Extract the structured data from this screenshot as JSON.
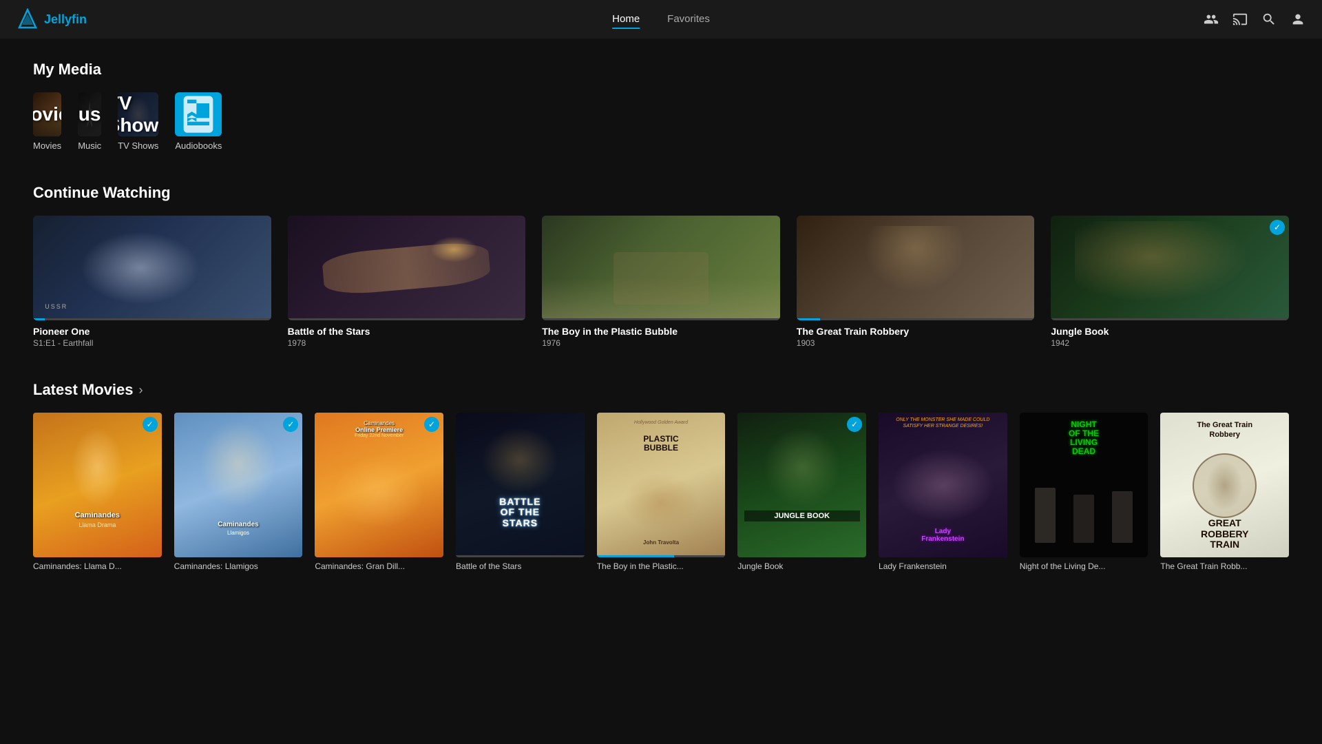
{
  "app": {
    "name": "Jellyfin"
  },
  "header": {
    "nav": [
      {
        "id": "home",
        "label": "Home",
        "active": true
      },
      {
        "id": "favorites",
        "label": "Favorites",
        "active": false
      }
    ],
    "icons": [
      "users-icon",
      "cast-icon",
      "search-icon",
      "user-icon"
    ]
  },
  "myMedia": {
    "title": "My Media",
    "items": [
      {
        "id": "movies",
        "label": "Movies",
        "sublabel": "Movies"
      },
      {
        "id": "music",
        "label": "Music",
        "sublabel": "Music"
      },
      {
        "id": "tvshows",
        "label": "TV Shows",
        "sublabel": "TV Shows"
      },
      {
        "id": "audiobooks",
        "label": "Audiobooks",
        "sublabel": "Audiobooks",
        "isAudiobooks": true
      }
    ]
  },
  "continueWatching": {
    "title": "Continue Watching",
    "items": [
      {
        "id": "pioneer-one",
        "title": "Pioneer One",
        "subtitle": "S1:E1 - Earthfall",
        "progress": 5,
        "hasCheck": false
      },
      {
        "id": "battle-stars",
        "title": "Battle of the Stars",
        "subtitle": "1978",
        "progress": 0,
        "hasCheck": false
      },
      {
        "id": "boy-bubble",
        "title": "The Boy in the Plastic Bubble",
        "subtitle": "1976",
        "progress": 0,
        "hasCheck": false
      },
      {
        "id": "great-train",
        "title": "The Great Train Robbery",
        "subtitle": "1903",
        "progress": 10,
        "hasCheck": false
      },
      {
        "id": "jungle-book",
        "title": "Jungle Book",
        "subtitle": "1942",
        "progress": 0,
        "hasCheck": true
      }
    ]
  },
  "latestMovies": {
    "title": "Latest Movies",
    "arrow": "›",
    "items": [
      {
        "id": "caminandes1",
        "title": "Caminandes: Llama D...",
        "hasCheck": true,
        "progress": 0
      },
      {
        "id": "caminandes2",
        "title": "Caminandes: Llamigos",
        "hasCheck": true,
        "progress": 0
      },
      {
        "id": "caminandes3",
        "title": "Caminandes: Gran Dill...",
        "hasCheck": true,
        "progress": 0
      },
      {
        "id": "battle-latest",
        "title": "Battle of the Stars",
        "hasCheck": false,
        "progress": 0
      },
      {
        "id": "bubble-latest",
        "title": "The Boy in the Plastic...",
        "hasCheck": false,
        "progress": 60
      },
      {
        "id": "jungle-latest",
        "title": "Jungle Book",
        "hasCheck": true,
        "progress": 0
      },
      {
        "id": "frankenstein",
        "title": "Lady Frankenstein",
        "hasCheck": false,
        "progress": 0
      },
      {
        "id": "night",
        "title": "Night of the Living De...",
        "hasCheck": false,
        "progress": 0
      },
      {
        "id": "train-latest",
        "title": "The Great Train Robb...",
        "hasCheck": false,
        "progress": 0
      }
    ]
  },
  "checkmark": "✓",
  "colors": {
    "accent": "#00a4dc",
    "bg": "#101010",
    "headerBg": "#1a1a1a",
    "cardBg": "#222"
  }
}
